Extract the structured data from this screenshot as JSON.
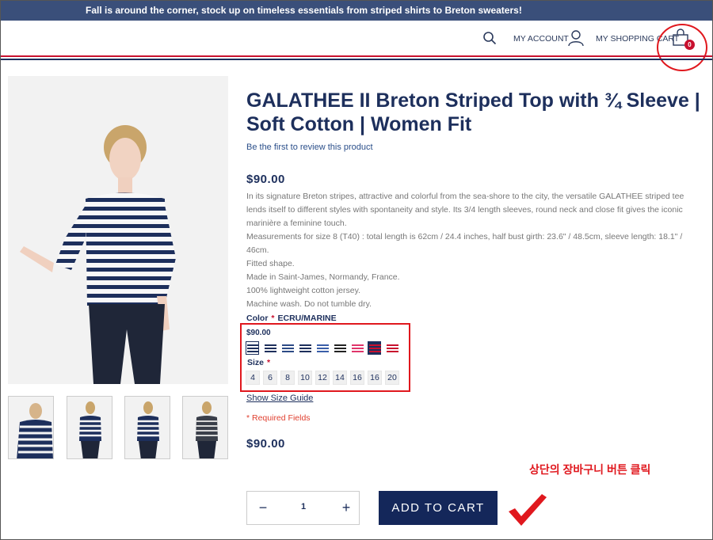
{
  "promo": {
    "text": "Fall is around the corner, stock up on timeless essentials from striped shirts to Breton sweaters!"
  },
  "header": {
    "account_label": "MY ACCOUNT",
    "cart_label": "MY SHOPPING CART",
    "cart_count": "0"
  },
  "product": {
    "title": "GALATHEE II Breton Striped Top with ¾ Sleeve | Soft Cotton | Women Fit",
    "review_link": "Be the first to review this product",
    "price": "$90.00",
    "description": [
      "In its signature Breton stripes, attractive and colorful from the sea-shore to the city, the versatile GALATHEE striped tee lends itself to different styles with spontaneity and style. Its 3/4 length sleeves, round neck and close fit gives the iconic marinière a feminine touch.",
      "Measurements for size 8 (T40) : total length is 62cm / 24.4 inches, half bust girth: 23.6\" / 48.5cm, sleeve length: 18.1\" / 46cm.",
      "Fitted shape.",
      "Made in Saint-James, Normandy, France.",
      "100% lightweight cotton jersey.",
      "Machine wash. Do not tumble dry."
    ],
    "color_label": "Color",
    "required_star": "*",
    "color_value": "ECRU/MARINE",
    "option_price": "$90.00",
    "size_label": "Size",
    "sizes": [
      "4",
      "6",
      "8",
      "10",
      "12",
      "14",
      "16",
      "16",
      "20"
    ],
    "size_guide": "Show Size Guide",
    "required_fields": "* Required Fields",
    "price_bottom": "$90.00"
  },
  "swatches": [
    {
      "name": "ecru-marine",
      "bg": "#ffffff",
      "line": "#1d2f5c",
      "border": "#1d2f5c"
    },
    {
      "name": "marine",
      "bg": "#ffffff",
      "line": "#1d2f5c",
      "border": "#ffffff"
    },
    {
      "name": "navy-white",
      "bg": "#ffffff",
      "line": "#2c4a85",
      "border": "#ffffff"
    },
    {
      "name": "white-navy",
      "bg": "#ffffff",
      "line": "#1d2f5c",
      "border": "#ffffff"
    },
    {
      "name": "blue",
      "bg": "#ffffff",
      "line": "#3a5ea8",
      "border": "#ffffff"
    },
    {
      "name": "black",
      "bg": "#ffffff",
      "line": "#222222",
      "border": "#ffffff"
    },
    {
      "name": "pink",
      "bg": "#ffffff",
      "line": "#e0356a",
      "border": "#ffffff"
    },
    {
      "name": "navy-red",
      "bg": "#1d2f5c",
      "line": "#c8102e",
      "border": "#1d2f5c"
    },
    {
      "name": "red",
      "bg": "#ffffff",
      "line": "#c8102e",
      "border": "#ffffff"
    }
  ],
  "quantity": {
    "minus": "−",
    "value": "1",
    "plus": "+"
  },
  "add_to_cart": "ADD TO CART",
  "annotation": "상단의 장바구니 버튼 클릭",
  "colors": {
    "navy": "#1d2f5c",
    "red": "#c8102e",
    "promo_bg": "#3a4f7a",
    "highlight": "#e0181e"
  }
}
